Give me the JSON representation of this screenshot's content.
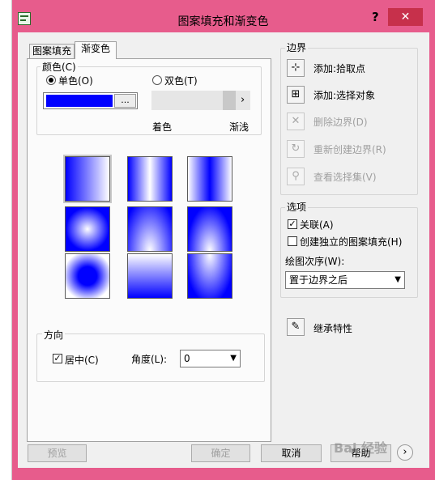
{
  "window": {
    "title": "图案填充和渐变色",
    "help": "?",
    "close": "✕"
  },
  "tabs": [
    "图案填充",
    "渐变色"
  ],
  "color_group": {
    "label": "颜色(C)",
    "one_color": "单色(O)",
    "two_color": "双色(T)",
    "swatch_color": "#0000ff",
    "pick_button": "...",
    "shade_label": "着色",
    "tint_label": "渐浅"
  },
  "orientation": {
    "label": "方向",
    "centered": "居中(C)",
    "angle_label": "角度(L):",
    "angle_value": "0"
  },
  "boundaries": {
    "label": "边界",
    "add_pick": "添加:拾取点",
    "add_select": "添加:选择对象",
    "remove": "删除边界(D)",
    "recreate": "重新创建边界(R)",
    "view": "查看选择集(V)"
  },
  "options": {
    "label": "选项",
    "associative": "关联(A)",
    "separate": "创建独立的图案填充(H)",
    "draw_order_label": "绘图次序(W):",
    "draw_order_value": "置于边界之后"
  },
  "inherit": "继承特性",
  "footer": {
    "preview": "预览",
    "ok": "确定",
    "cancel": "取消",
    "help": "帮助"
  },
  "watermark": "Bai 经验"
}
